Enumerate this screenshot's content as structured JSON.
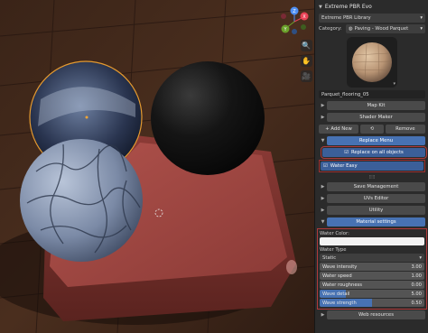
{
  "panel": {
    "addon_title": "Extreme PBR Evo",
    "library_selector": "Extreme PBR Library",
    "category_label": "Category:",
    "category_value": "Paving - Wood Parquet",
    "material_name": "Parquet_flooring_05",
    "map_kit": "Map Kit",
    "shader_maker": "Shader Maker",
    "add_new": "+ Add New",
    "remove": "Remove",
    "replace_menu": "Replace Menu",
    "replace_all": "Replace on all objects",
    "water_easy": "Water Easy",
    "save_management": "Save Management",
    "uvs_editor": "UVs Editor",
    "utility": "Utility",
    "material_settings": "Material settings",
    "water_color": "Water Color:",
    "water_type": "Water Type",
    "water_type_value": "Static",
    "params": [
      {
        "label": "Wave intensity",
        "value": "3.00",
        "fill": 0.0
      },
      {
        "label": "Water speed",
        "value": "1.00",
        "fill": 0.0
      },
      {
        "label": "Water roughness",
        "value": "0.00",
        "fill": 0.0
      },
      {
        "label": "Wave detail",
        "value": "5.00",
        "fill": 0.25
      },
      {
        "label": "Wave strength",
        "value": "0.50",
        "fill": 0.5
      }
    ],
    "web_resources": "Web resources"
  },
  "colors": {
    "accent_blue": "#4772b3",
    "highlight_red": "#b03a3a",
    "gizmo_x": "#e84356",
    "gizmo_y": "#6ba12b",
    "gizmo_z": "#4f8ff2"
  },
  "gizmo": {
    "x": "X",
    "y": "Y",
    "z": "Z"
  }
}
